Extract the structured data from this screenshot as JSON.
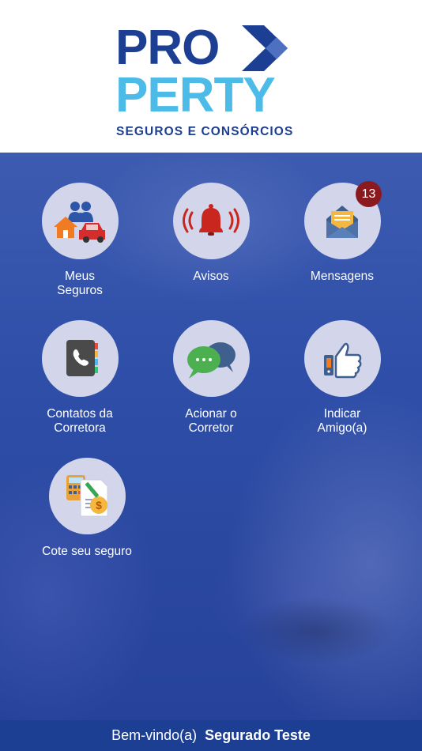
{
  "brand": {
    "line1": "PRO",
    "line2": "PERTY",
    "tagline": "SEGUROS E CONSÓRCIOS",
    "colors": {
      "primary": "#1c3f94",
      "secondary": "#4dbbe8"
    }
  },
  "menu": [
    {
      "icon": "family-home-car-icon",
      "label_line1": "Meus",
      "label_line2": "Seguros"
    },
    {
      "icon": "alarm-bell-icon",
      "label_line1": "Avisos",
      "label_line2": ""
    },
    {
      "icon": "envelope-message-icon",
      "label_line1": "Mensagens",
      "label_line2": "",
      "badge": "13"
    },
    {
      "icon": "phone-book-icon",
      "label_line1": "Contatos da",
      "label_line2": "Corretora"
    },
    {
      "icon": "chat-bubbles-icon",
      "label_line1": "Acionar o",
      "label_line2": "Corretor"
    },
    {
      "icon": "thumbs-up-icon",
      "label_line1": "Indicar",
      "label_line2": "Amigo(a)"
    },
    {
      "icon": "calculator-quote-icon",
      "label_line1": "Cote seu seguro",
      "label_line2": ""
    }
  ],
  "footer": {
    "greeting": "Bem-vindo(a)",
    "user_name": "Segurado Teste"
  }
}
